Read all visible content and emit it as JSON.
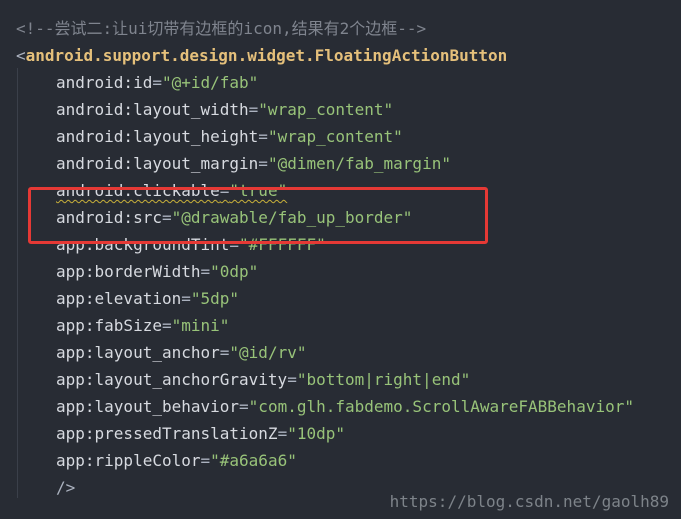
{
  "comment_line": "<!--尝试二:让ui切带有边框的icon,结果有2个边框-->",
  "tag_open_bracket": "<",
  "tag_name": "android.support.design.widget.FloatingActionButton",
  "attributes": [
    {
      "name": "android:id",
      "value": "\"@+id/fab\""
    },
    {
      "name": "android:layout_width",
      "value": "\"wrap_content\""
    },
    {
      "name": "android:layout_height",
      "value": "\"wrap_content\""
    },
    {
      "name": "android:layout_margin",
      "value": "\"@dimen/fab_margin\""
    },
    {
      "name": "android:clickable",
      "value": "\"true\""
    },
    {
      "name": "android:src",
      "value": "\"@drawable/fab_up_border\""
    },
    {
      "name": "app:backgroundTint",
      "value": "\"#FFFFFF\""
    },
    {
      "name": "app:borderWidth",
      "value": "\"0dp\""
    },
    {
      "name": "app:elevation",
      "value": "\"5dp\""
    },
    {
      "name": "app:fabSize",
      "value": "\"mini\""
    },
    {
      "name": "app:layout_anchor",
      "value": "\"@id/rv\""
    },
    {
      "name": "app:layout_anchorGravity",
      "value": "\"bottom|right|end\""
    },
    {
      "name": "app:layout_behavior",
      "value": "\"com.glh.fabdemo.ScrollAwareFABBehavior\""
    },
    {
      "name": "app:pressedTranslationZ",
      "value": "\"10dp\""
    },
    {
      "name": "app:rippleColor",
      "value": "\"#a6a6a6\""
    }
  ],
  "eq": "=",
  "close_tag": "/>",
  "watermark": "https://blog.csdn.net/gaolh89",
  "colors": {
    "background": "#282c34",
    "tag": "#e5c07b",
    "attribute_value": "#98c379",
    "comment": "#7f848e",
    "highlight_box": "#e53935"
  }
}
